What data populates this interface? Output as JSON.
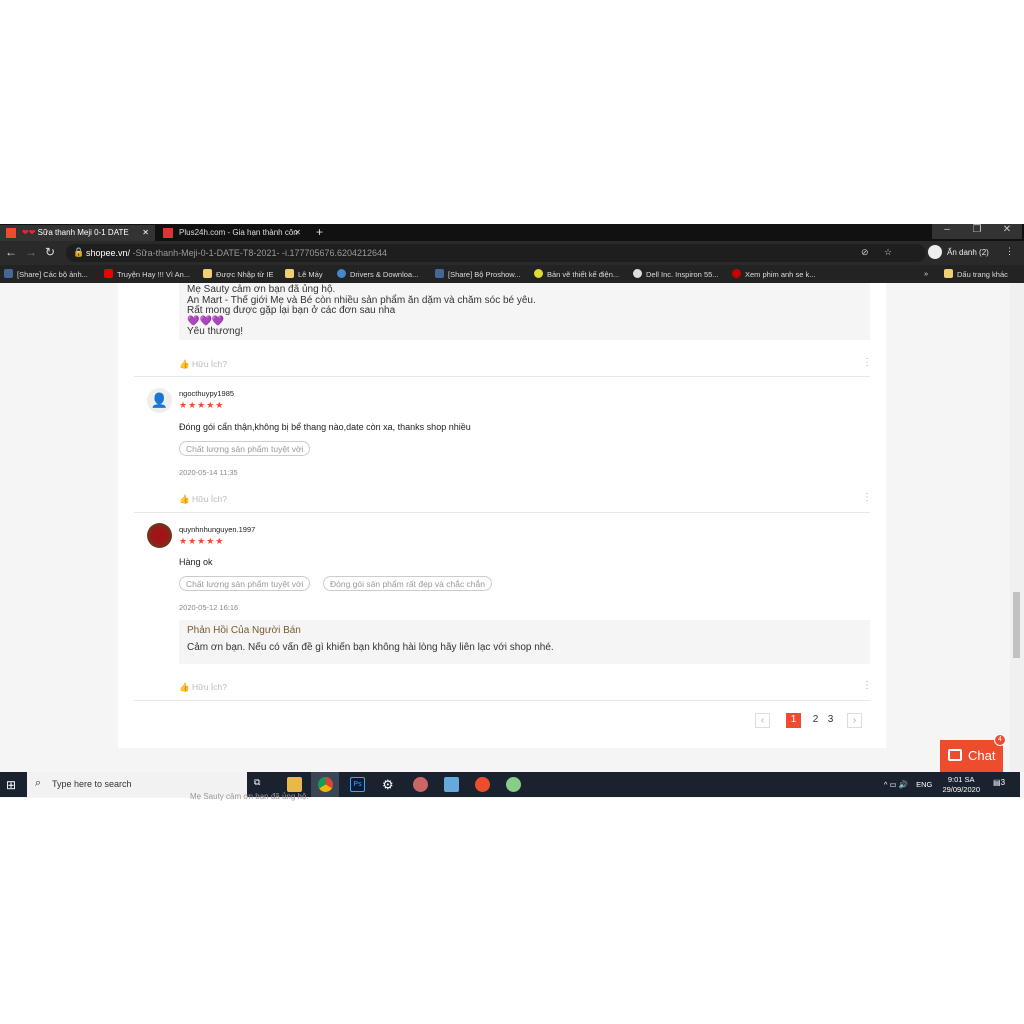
{
  "browser": {
    "tabs": [
      {
        "title": "Sữa thanh Meji 0-1 DATE",
        "active": true
      },
      {
        "title": "Plus24h.com - Gia hạn thành côn",
        "active": false
      }
    ],
    "new_tab": "+",
    "url_host": "shopee.vn/",
    "url_path": " -Sữa-thanh-Meji-0-1-DATE-T8-2021- -i.177705676.6204212644",
    "profile": "Ẩn danh (2)",
    "bookmarks": [
      "[Share] Các bộ ảnh...",
      "Truyện Hay !!! Vì An...",
      "Được Nhập từ IE",
      "Lê Máy",
      "Drivers & Downloa...",
      "[Share] Bộ Proshow...",
      "Bản vẽ thiết kế điện...",
      "Dell Inc. Inspiron 55...",
      "Xem phim anh se k..."
    ],
    "bookmarks_more": "»",
    "other_bookmarks": "Dấu trang khác"
  },
  "reviews": {
    "first_reply_lines": [
      "Mẹ Sauty cảm ơn bạn đã ủng hộ.",
      "An Mart - Thế giới Mẹ và Bé còn nhiều sản phẩm ăn dặm và chăm sóc bé yêu.",
      "Rất mong được gặp lại bạn ở các đơn sau nha",
      "💜💜💜",
      "Yêu thương!"
    ],
    "useful_label": "Hữu Ích?",
    "items": [
      {
        "user": "ngocthuypy1985",
        "stars": 5,
        "text": "Đóng gói cẩn thận,không bị bể thang nào,date còn xa, thanks shop nhiều",
        "tags": [
          "Chất lượng sản phẩm tuyệt vời"
        ],
        "date": "2020-05-14 11:35"
      },
      {
        "user": "quynhnhunguyen.1997",
        "stars": 5,
        "text": "Hàng ok",
        "tags": [
          "Chất lượng sản phẩm tuyệt vời",
          "Đóng gói sản phẩm rất đẹp và chắc chắn"
        ],
        "date": "2020-05-12 16:16",
        "reply_title": "Phản Hồi Của Người Bán",
        "reply_text": "Cảm ơn bạn. Nếu có vấn đề gì khiến bạn không hài lòng hãy liên lạc với shop nhé."
      }
    ],
    "star_glyphs": "★★★★★"
  },
  "pagination": {
    "prev": "‹",
    "pages": [
      "1",
      "2",
      "3"
    ],
    "current": "1",
    "next": "›"
  },
  "chat": {
    "label": "Chat",
    "badge": "4"
  },
  "taskbar": {
    "search_placeholder": "Type here to search",
    "lang": "ENG",
    "time": "9:01 SA",
    "date": "29/09/2020",
    "notifications": "3"
  },
  "below_text": "Mẹ Sauty cảm ơn bạn đã ủng hộ.",
  "colors": {
    "accent": "#ee4d2d",
    "reply_title": "#7b5a2e"
  }
}
